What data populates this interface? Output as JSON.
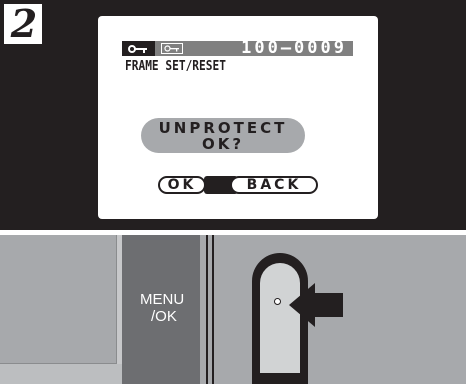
{
  "step": {
    "number": "2"
  },
  "screen": {
    "frame_number": "100–0009",
    "menu_title": "FRAME SET/RESET",
    "dialog": {
      "line1": "UNPROTECT",
      "line2": "OK?"
    },
    "buttons": {
      "ok": "OK",
      "back": "BACK"
    }
  },
  "camera": {
    "menu_label_line1": "MENU",
    "menu_label_line2": "/OK"
  },
  "colors": {
    "panel": "#231f20",
    "status_bar": "#808080",
    "dialog": "#a7a9ac",
    "camera_body": "#6d6e71"
  },
  "icons": [
    "protect-key-icon",
    "protect-key-outline-icon",
    "pointer-arrow-icon"
  ]
}
